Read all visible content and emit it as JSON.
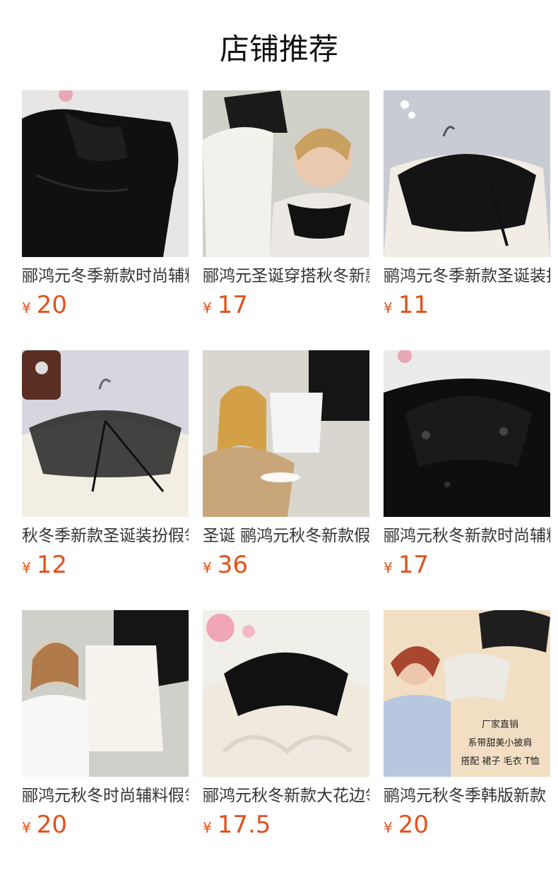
{
  "page": {
    "title": "店铺推荐"
  },
  "products": [
    {
      "name": "郦鸿元冬季新款时尚辅料",
      "currency": "¥",
      "price": "20",
      "image": "black-shirt-collar-photo"
    },
    {
      "name": "郦鸿元圣诞穿搭秋冬新款",
      "currency": "¥",
      "price": "17",
      "image": "lace-collar-model-photo"
    },
    {
      "name": "鹂鸿元冬季新款圣诞装扮",
      "currency": "¥",
      "price": "11",
      "image": "black-lace-cape-collar-photo"
    },
    {
      "name": "秋冬季新款圣诞装扮假领",
      "currency": "¥",
      "price": "12",
      "image": "sheer-black-collar-photo"
    },
    {
      "name": "圣诞 鹂鸿元秋冬新款假领",
      "currency": "¥",
      "price": "36",
      "image": "pearl-collar-model-photo"
    },
    {
      "name": "郦鸿元秋冬新款时尚辅料",
      "currency": "¥",
      "price": "17",
      "image": "beaded-black-collar-photo"
    },
    {
      "name": "郦鸿元秋冬时尚辅料假领",
      "currency": "¥",
      "price": "20",
      "image": "white-bib-collar-model-photo"
    },
    {
      "name": "郦鸿元秋冬新款大花边领",
      "currency": "¥",
      "price": "17.5",
      "image": "black-scalloped-collar-photo"
    },
    {
      "name": "鹂鸿元秋冬季韩版新款",
      "currency": "¥",
      "price": "20",
      "image": "embroidered-cape-collar-model-photo"
    }
  ],
  "promo_overlay": {
    "lines": [
      "厂家直销",
      "系带甜美小披肩",
      "搭配 裙子 毛衣 T恤"
    ]
  },
  "colors": {
    "price": "#e4501b",
    "title": "#111111",
    "name": "#333333"
  }
}
